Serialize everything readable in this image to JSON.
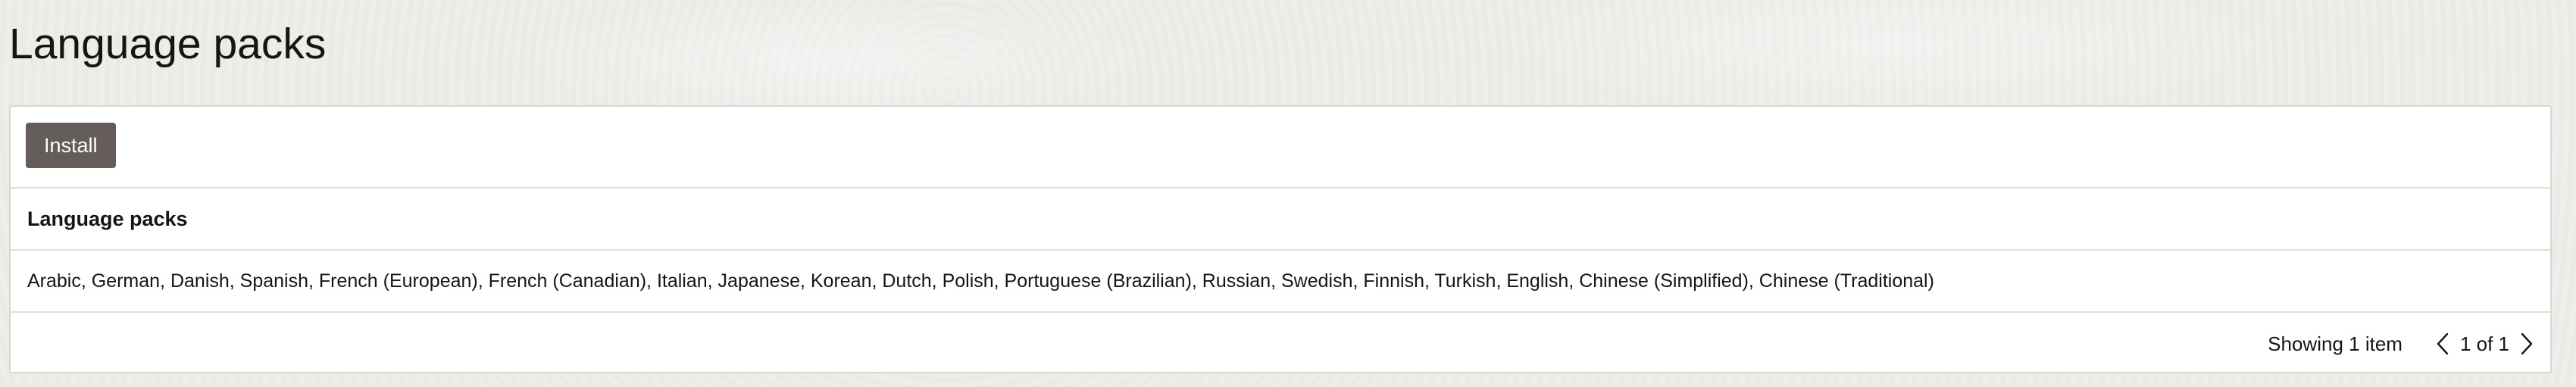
{
  "page": {
    "title": "Language packs"
  },
  "toolbar": {
    "install_label": "Install"
  },
  "table": {
    "column_header": "Language packs",
    "rows": [
      "Arabic, German, Danish, Spanish, French (European), French (Canadian), Italian, Japanese, Korean, Dutch, Polish, Portuguese (Brazilian), Russian, Swedish, Finnish, Turkish, English, Chinese (Simplified), Chinese (Traditional)"
    ]
  },
  "footer": {
    "showing": "Showing 1 item",
    "page_status": "1 of 1",
    "prev_icon": "chevron-left-icon",
    "next_icon": "chevron-right-icon"
  },
  "colors": {
    "background": "#efedea",
    "button": "#645d59",
    "border": "#d9d6d2"
  }
}
